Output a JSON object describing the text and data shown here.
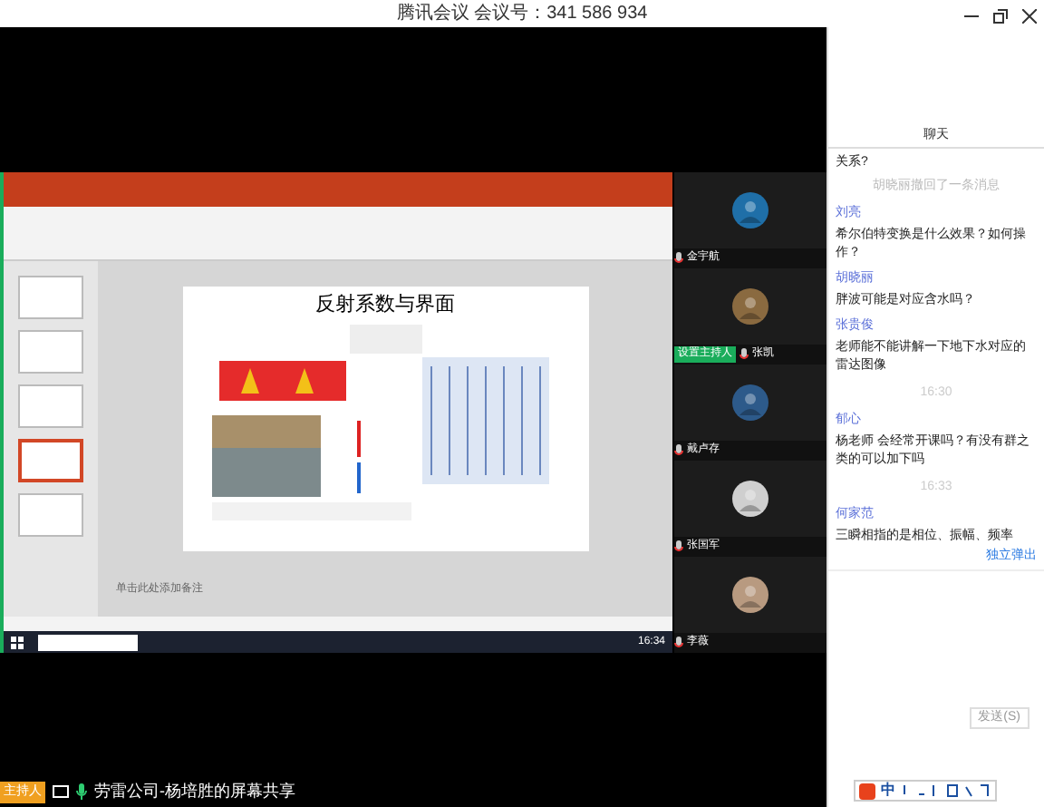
{
  "window": {
    "title": "腾讯会议 会议号：341 586 934"
  },
  "shared_screen": {
    "slide_title": "反射系数与界面",
    "notes_placeholder": "单击此处添加备注",
    "clock": "16:34",
    "thumbnails": [
      {
        "selected": false
      },
      {
        "selected": false
      },
      {
        "selected": false
      },
      {
        "selected": true
      },
      {
        "selected": false
      }
    ]
  },
  "participants": [
    {
      "name": "金宇航",
      "set_host_button": false
    },
    {
      "name": "张凯",
      "set_host_button": true
    },
    {
      "name": "戴卢存",
      "set_host_button": false
    },
    {
      "name": "张国军",
      "set_host_button": false
    },
    {
      "name": "李薇",
      "set_host_button": false
    }
  ],
  "set_host_label": "设置主持人",
  "status_bar": {
    "role_badge": "主持人",
    "share_text": "劳雷公司-杨培胜的屏幕共享"
  },
  "chat": {
    "title": "聊天",
    "messages": [
      {
        "kind": "message",
        "text": "关系?"
      },
      {
        "kind": "notice",
        "text": "胡晓丽撤回了一条消息"
      },
      {
        "kind": "message",
        "sender": "刘亮",
        "text": "希尔伯特变换是什么效果？如何操作？"
      },
      {
        "kind": "message",
        "sender": "胡晓丽",
        "text": "胖波可能是对应含水吗？"
      },
      {
        "kind": "message",
        "sender": "张贵俊",
        "text": "老师能不能讲解一下地下水对应的雷达图像"
      },
      {
        "kind": "time",
        "text": "16:30"
      },
      {
        "kind": "message",
        "sender": "郁心",
        "text": "杨老师 会经常开课吗？有没有群之类的可以加下吗"
      },
      {
        "kind": "time",
        "text": "16:33"
      },
      {
        "kind": "message",
        "sender": "何家范",
        "text": "三瞬相指的是相位、振幅、频率"
      }
    ],
    "popout_link": "独立弹出",
    "send_button": "发送(S)",
    "ime_mode": "中"
  }
}
